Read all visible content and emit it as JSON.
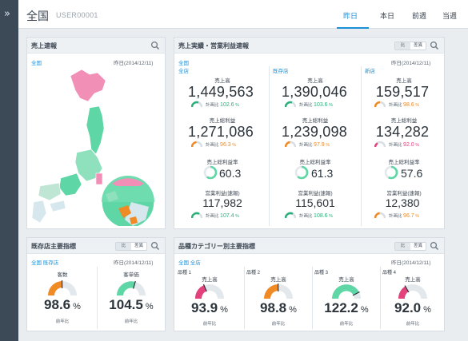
{
  "header": {
    "scope": "全国",
    "user_id": "USER00001",
    "tabs": [
      {
        "label": "昨日",
        "active": true
      },
      {
        "label": "本日",
        "active": false
      },
      {
        "label": "前週",
        "active": false
      },
      {
        "label": "当週",
        "active": false
      }
    ],
    "accent_color": "#1c8fd6"
  },
  "sales_map": {
    "title": "売上速報",
    "scope": "全国",
    "date": "昨日(2014/12/11)",
    "colors": {
      "high": "#f28fb6",
      "mid": "#5ed6a5",
      "low": "#d6e8ee",
      "accent": "#f08a24"
    }
  },
  "sales_profit": {
    "title": "売上実績・営業利益速報",
    "toggle": [
      "比",
      "差異"
    ],
    "scope": "全国",
    "date": "昨日(2014/12/11)",
    "plan_label": "計画比",
    "columns": [
      {
        "name": "全店",
        "sales_label": "売上高",
        "sales": "1,449,563",
        "sales_plan": "102.6",
        "sales_color": "g",
        "gross_label": "売上総利益",
        "gross": "1,271,086",
        "gross_plan": "96.3",
        "gross_color": "o",
        "margin_label": "売上総利益率",
        "margin": "60.3",
        "margin_ratio": 0.603,
        "op_label": "営業利益(速報)",
        "op": "117,982",
        "op_plan": "107.4",
        "op_color": "g"
      },
      {
        "name": "既存店",
        "sales_label": "売上高",
        "sales": "1,390,046",
        "sales_plan": "103.6",
        "sales_color": "g",
        "gross_label": "売上総利益",
        "gross": "1,239,098",
        "gross_plan": "97.9",
        "gross_color": "o",
        "margin_label": "売上総利益率",
        "margin": "61.3",
        "margin_ratio": 0.613,
        "op_label": "営業利益(速報)",
        "op": "115,601",
        "op_plan": "108.6",
        "op_color": "g"
      },
      {
        "name": "新店",
        "sales_label": "売上高",
        "sales": "159,517",
        "sales_plan": "98.6",
        "sales_color": "o",
        "gross_label": "売上総利益",
        "gross": "134,282",
        "gross_plan": "92.0",
        "gross_color": "r",
        "margin_label": "売上総利益率",
        "margin": "57.6",
        "margin_ratio": 0.576,
        "op_label": "営業利益(速報)",
        "op": "12,380",
        "op_plan": "96.7",
        "op_color": "o"
      }
    ]
  },
  "existing_kpi": {
    "title": "既存店主要指標",
    "toggle": [
      "比",
      "差異"
    ],
    "scope": "全国 既存店",
    "date": "昨日(2014/12/11)",
    "items": [
      {
        "label": "客数",
        "value": "98.6",
        "unit": "%",
        "foot": "前年比",
        "ratio": 0.49,
        "color": "#f08a24"
      },
      {
        "label": "客単価",
        "value": "104.5",
        "unit": "%",
        "foot": "前年比",
        "ratio": 0.6,
        "color": "#5ed6a5"
      }
    ]
  },
  "category_kpi": {
    "title": "品種カテゴリー別主要指標",
    "toggle": [
      "比",
      "差異"
    ],
    "scope": "全国 全店",
    "date": "昨日(2014/12/11)",
    "items": [
      {
        "name": "品種 1",
        "label": "売上高",
        "value": "93.9",
        "unit": "%",
        "foot": "前年比",
        "ratio": 0.35,
        "color": "#e3417c"
      },
      {
        "name": "品種 2",
        "label": "売上高",
        "value": "98.8",
        "unit": "%",
        "foot": "前年比",
        "ratio": 0.49,
        "color": "#f08a24"
      },
      {
        "name": "品種 3",
        "label": "売上高",
        "value": "122.2",
        "unit": "%",
        "foot": "前年比",
        "ratio": 0.85,
        "color": "#5ed6a5"
      },
      {
        "name": "品種 4",
        "label": "売上高",
        "value": "92.0",
        "unit": "%",
        "foot": "前年比",
        "ratio": 0.3,
        "color": "#e3417c"
      }
    ]
  }
}
